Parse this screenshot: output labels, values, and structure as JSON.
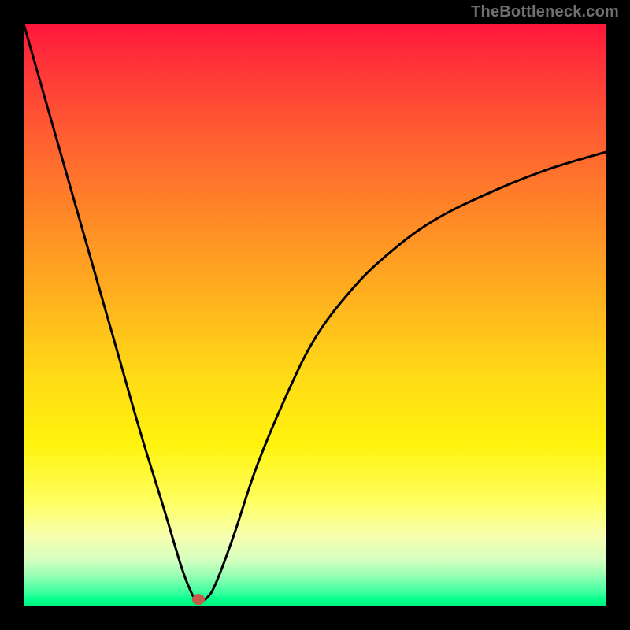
{
  "watermark": "TheBottleneck.com",
  "colors": {
    "frame": "#000000",
    "curve_stroke": "#000000",
    "dot_fill": "#c85a4a",
    "gradient_top": "#ff163c",
    "gradient_bottom": "#00f07f"
  },
  "chart_data": {
    "type": "line",
    "title": "",
    "xlabel": "",
    "ylabel": "",
    "xlim": [
      0,
      100
    ],
    "ylim": [
      0,
      100
    ],
    "grid": false,
    "series": [
      {
        "name": "bottleneck-curve",
        "x": [
          0,
          4,
          8,
          12,
          16,
          20,
          24,
          27,
          28.5,
          29.5,
          30.5,
          31.5,
          33,
          36,
          40,
          45,
          50,
          56,
          62,
          70,
          80,
          90,
          100
        ],
        "y": [
          100,
          86,
          72,
          58,
          44,
          30,
          17,
          7,
          3,
          1.2,
          1.2,
          1.5,
          4,
          12,
          24,
          36,
          46,
          54,
          60,
          66,
          71,
          75,
          78
        ]
      }
    ],
    "annotations": [
      {
        "name": "minimum-dot",
        "x": 30,
        "y": 1.2
      }
    ]
  }
}
